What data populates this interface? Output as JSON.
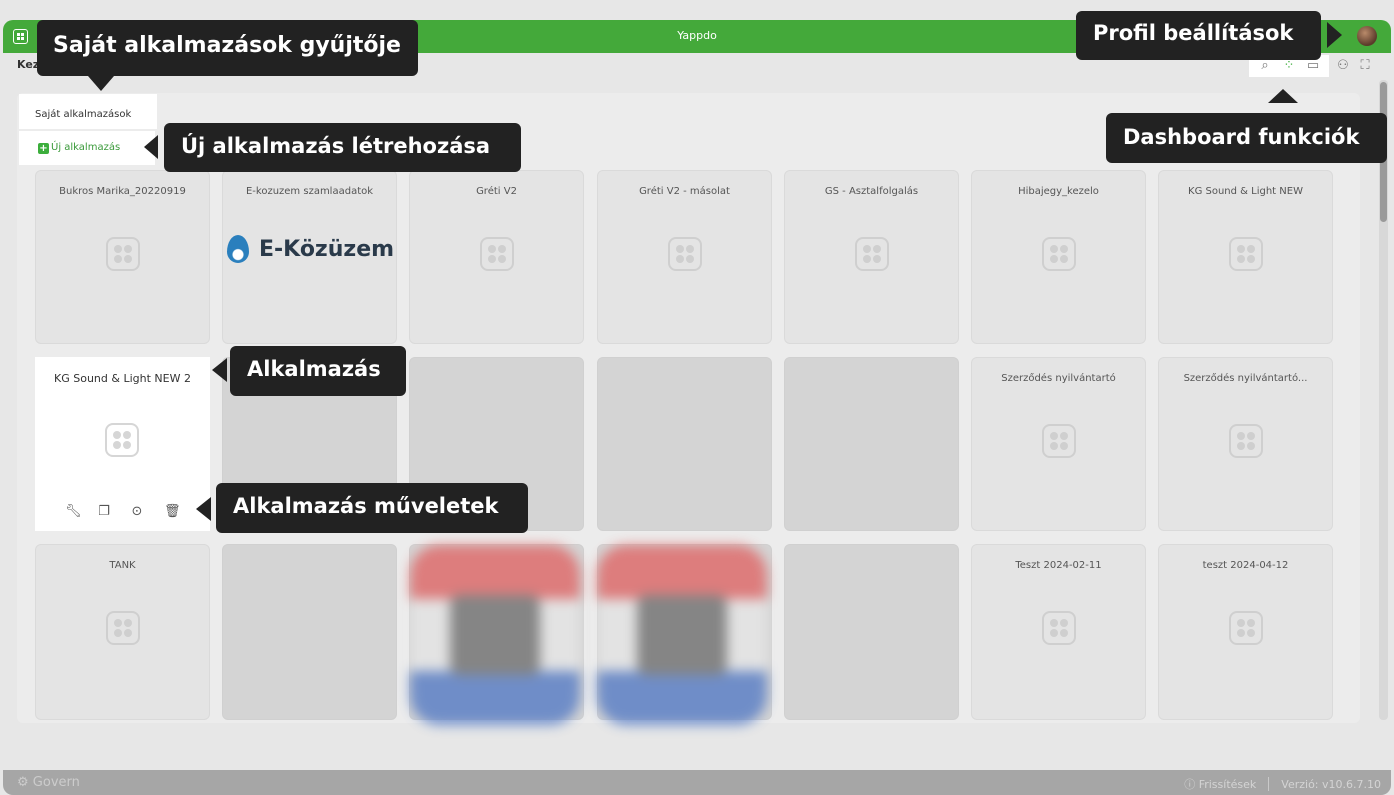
{
  "window": {
    "title": "Yappdo"
  },
  "breadcrumb": {
    "label": "Kez"
  },
  "sidebar": {
    "tab_label": "Saját alkalmazások",
    "new_app_label": "Új alkalmazás",
    "new_app_plus": "+"
  },
  "toolbar": {
    "icons": [
      "search-icon",
      "grid-view-icon",
      "folder-icon",
      "users-icon",
      "fullscreen-icon"
    ]
  },
  "apps": [
    {
      "name": "Bukros Marika_20220919"
    },
    {
      "name": "E-kozuzem szamlaadatok",
      "logo_text": "E-Közüzem"
    },
    {
      "name": "Gréti V2"
    },
    {
      "name": "Gréti V2 - másolat"
    },
    {
      "name": "GS - Asztalfolgalás"
    },
    {
      "name": "Hibajegy_kezelo"
    },
    {
      "name": "KG Sound & Light NEW"
    },
    {
      "name": "KG Sound & Light NEW 2"
    },
    {
      "name": "Szerződés nyilvántartó"
    },
    {
      "name": "Szerződés nyilvántartó..."
    },
    {
      "name": "TANK"
    },
    {
      "name": "Teszt 2024-02-11"
    },
    {
      "name": "teszt 2024-04-12"
    }
  ],
  "app_actions": [
    "wrench-icon",
    "copy-icon",
    "play-icon",
    "trash-icon"
  ],
  "callouts": {
    "own_apps": "Saját alkalmazások gyűjtője",
    "profile": "Profil beállítások",
    "new_app": "Új alkalmazás létrehozása",
    "dashboard": "Dashboard funkciók",
    "app": "Alkalmazás",
    "app_actions": "Alkalmazás műveletek"
  },
  "footer": {
    "brand": "Govern",
    "updates": "Frissítések",
    "version": "Verzió: v10.6.7.10"
  },
  "colors": {
    "brand_green": "#44a93a",
    "callout_bg": "#222222"
  }
}
